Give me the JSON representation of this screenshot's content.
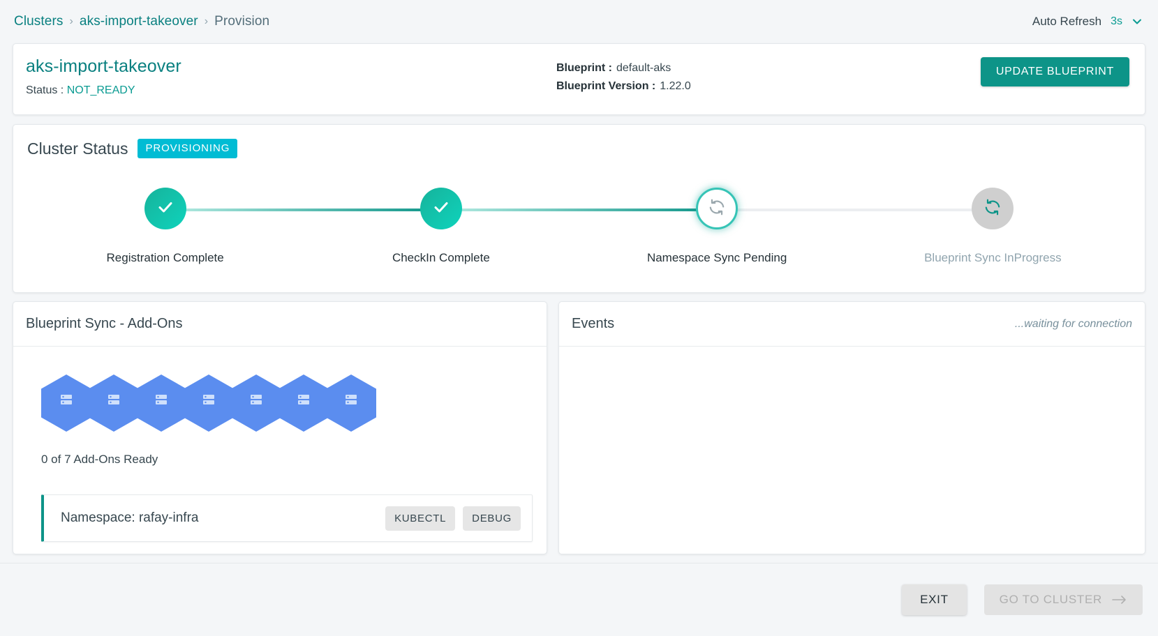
{
  "breadcrumb": {
    "items": [
      "Clusters",
      "aks-import-takeover",
      "Provision"
    ],
    "separator": "›"
  },
  "auto_refresh": {
    "label": "Auto Refresh",
    "value": "3s",
    "chevron_icon": "chevron-down-icon"
  },
  "summary": {
    "cluster_name": "aks-import-takeover",
    "status_label": "Status :",
    "status_value": "NOT_READY",
    "blueprint_label": "Blueprint :",
    "blueprint_value": "default-aks",
    "blueprint_version_label": "Blueprint Version :",
    "blueprint_version_value": "1.22.0",
    "update_button": "UPDATE BLUEPRINT"
  },
  "cluster_status": {
    "title": "Cluster Status",
    "badge": "PROVISIONING",
    "steps": [
      {
        "label": "Registration Complete",
        "state": "done",
        "icon": "check-icon"
      },
      {
        "label": "CheckIn Complete",
        "state": "done",
        "icon": "check-icon"
      },
      {
        "label": "Namespace Sync Pending",
        "state": "current",
        "icon": "sync-icon"
      },
      {
        "label": "Blueprint Sync InProgress",
        "state": "pending",
        "icon": "sync-icon"
      }
    ]
  },
  "addons_panel": {
    "title": "Blueprint Sync - Add-Ons",
    "hex_count": 7,
    "hex_icon": "server-icon",
    "ready_text": "0 of 7 Add-Ons Ready",
    "namespace_row": {
      "name": "Namespace: rafay-infra",
      "kubectl_button": "KUBECTL",
      "debug_button": "DEBUG"
    }
  },
  "events_panel": {
    "title": "Events",
    "status_text": "...waiting for connection"
  },
  "footer": {
    "exit_button": "EXIT",
    "goto_button": "GO TO CLUSTER",
    "goto_arrow_icon": "arrow-right-icon"
  },
  "colors": {
    "teal": "#0d9488",
    "teal_link": "#0a8080",
    "cyan_badge": "#00bcd4",
    "hex_blue": "#5b8def",
    "page_bg": "#f4f6f8"
  }
}
